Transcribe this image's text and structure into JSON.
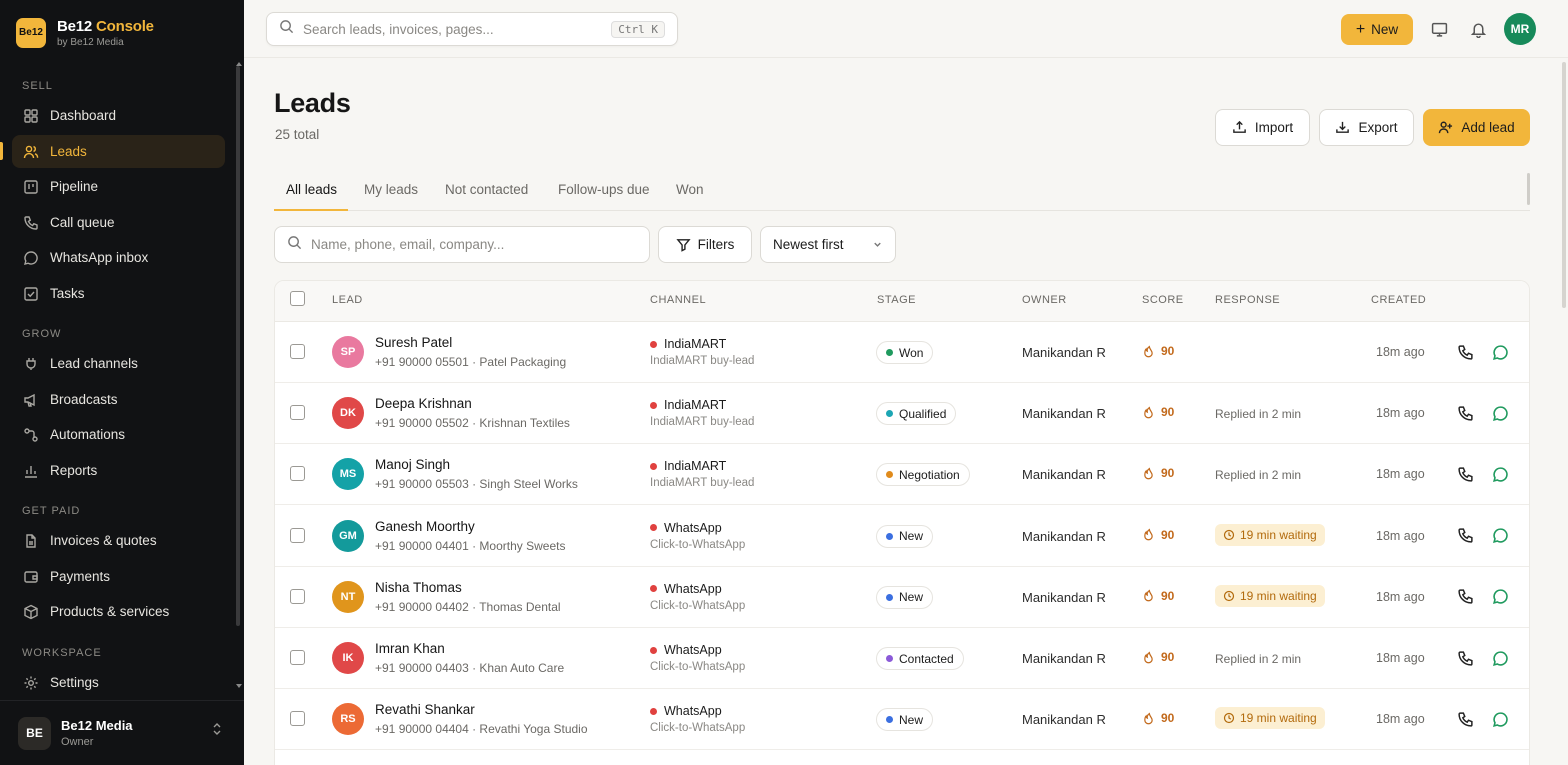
{
  "brand": {
    "name_part1": "Be12",
    "name_part2": "Console",
    "subtitle": "by Be12 Media",
    "logo_text": "Be12"
  },
  "sidebar": {
    "sections": [
      {
        "label": "SELL"
      },
      {
        "label": "GROW"
      },
      {
        "label": "GET PAID"
      },
      {
        "label": "WORKSPACE"
      }
    ],
    "items": [
      {
        "label": "Dashboard",
        "icon": "grid-icon"
      },
      {
        "label": "Leads",
        "icon": "users-icon",
        "active": true
      },
      {
        "label": "Pipeline",
        "icon": "kanban-icon"
      },
      {
        "label": "Call queue",
        "icon": "phone-icon"
      },
      {
        "label": "WhatsApp inbox",
        "icon": "chat-icon"
      },
      {
        "label": "Tasks",
        "icon": "checkbox-icon"
      },
      {
        "label": "Lead channels",
        "icon": "plug-icon"
      },
      {
        "label": "Broadcasts",
        "icon": "megaphone-icon"
      },
      {
        "label": "Automations",
        "icon": "workflow-icon"
      },
      {
        "label": "Reports",
        "icon": "bar-chart-icon"
      },
      {
        "label": "Invoices & quotes",
        "icon": "file-icon"
      },
      {
        "label": "Payments",
        "icon": "wallet-icon"
      },
      {
        "label": "Products & services",
        "icon": "box-icon"
      },
      {
        "label": "Settings",
        "icon": "gear-icon"
      }
    ],
    "workspace": {
      "avatar": "BE",
      "name": "Be12 Media",
      "role": "Owner"
    }
  },
  "topbar": {
    "search_placeholder": "Search leads, invoices, pages...",
    "shortcut": "Ctrl K",
    "new_label": "New",
    "user_initials": "MR"
  },
  "page": {
    "title": "Leads",
    "subtitle": "25 total",
    "import_label": "Import",
    "export_label": "Export",
    "add_label": "Add lead"
  },
  "tabs": [
    {
      "label": "All leads",
      "active": true
    },
    {
      "label": "My leads"
    },
    {
      "label": "Not contacted"
    },
    {
      "label": "Follow-ups due"
    },
    {
      "label": "Won"
    }
  ],
  "filters": {
    "search_placeholder": "Name, phone, email, company...",
    "filters_label": "Filters",
    "sort_value": "Newest first"
  },
  "table": {
    "headers": [
      "LEAD",
      "CHANNEL",
      "STAGE",
      "OWNER",
      "SCORE",
      "RESPONSE",
      "CREATED"
    ],
    "rows": [
      {
        "initials": "SP",
        "avatar_color": "#e9799f",
        "name": "Suresh Patel",
        "meta": "+91 90000 05501 · Patel Packaging",
        "channel": "IndiaMART",
        "channel_sub": "IndiaMART buy-lead",
        "stage": "Won",
        "stage_color": "#1f9a5e",
        "owner": "Manikandan R",
        "score": "90",
        "response": "",
        "response_type": "none",
        "created": "18m ago"
      },
      {
        "initials": "DK",
        "avatar_color": "#e04848",
        "name": "Deepa Krishnan",
        "meta": "+91 90000 05502 · Krishnan Textiles",
        "channel": "IndiaMART",
        "channel_sub": "IndiaMART buy-lead",
        "stage": "Qualified",
        "stage_color": "#1ca6b4",
        "owner": "Manikandan R",
        "score": "90",
        "response": "Replied in 2 min",
        "response_type": "text",
        "created": "18m ago"
      },
      {
        "initials": "MS",
        "avatar_color": "#14a2a7",
        "name": "Manoj Singh",
        "meta": "+91 90000 05503 · Singh Steel Works",
        "channel": "IndiaMART",
        "channel_sub": "IndiaMART buy-lead",
        "stage": "Negotiation",
        "stage_color": "#e08b1c",
        "owner": "Manikandan R",
        "score": "90",
        "response": "Replied in 2 min",
        "response_type": "text",
        "created": "18m ago"
      },
      {
        "initials": "GM",
        "avatar_color": "#139a9b",
        "name": "Ganesh Moorthy",
        "meta": "+91 90000 04401 · Moorthy Sweets",
        "channel": "WhatsApp",
        "channel_sub": "Click-to-WhatsApp",
        "stage": "New",
        "stage_color": "#3b6fe0",
        "owner": "Manikandan R",
        "score": "90",
        "response": "19 min waiting",
        "response_type": "badge",
        "created": "18m ago"
      },
      {
        "initials": "NT",
        "avatar_color": "#e0951c",
        "name": "Nisha Thomas",
        "meta": "+91 90000 04402 · Thomas Dental",
        "channel": "WhatsApp",
        "channel_sub": "Click-to-WhatsApp",
        "stage": "New",
        "stage_color": "#3b6fe0",
        "owner": "Manikandan R",
        "score": "90",
        "response": "19 min waiting",
        "response_type": "badge",
        "created": "18m ago"
      },
      {
        "initials": "IK",
        "avatar_color": "#e04848",
        "name": "Imran Khan",
        "meta": "+91 90000 04403 · Khan Auto Care",
        "channel": "WhatsApp",
        "channel_sub": "Click-to-WhatsApp",
        "stage": "Contacted",
        "stage_color": "#8b5ad8",
        "owner": "Manikandan R",
        "score": "90",
        "response": "Replied in 2 min",
        "response_type": "text",
        "created": "18m ago"
      },
      {
        "initials": "RS",
        "avatar_color": "#ec6a35",
        "name": "Revathi Shankar",
        "meta": "+91 90000 04404 · Revathi Yoga Studio",
        "channel": "WhatsApp",
        "channel_sub": "Click-to-WhatsApp",
        "stage": "New",
        "stage_color": "#3b6fe0",
        "owner": "Manikandan R",
        "score": "90",
        "response": "19 min waiting",
        "response_type": "badge",
        "created": "18m ago"
      }
    ]
  },
  "colors": {
    "accent": "#f2b63b",
    "sidebar_bg": "#111214",
    "whatsapp_green": "#1f9a5e",
    "channel_dot": "#e0413f"
  }
}
